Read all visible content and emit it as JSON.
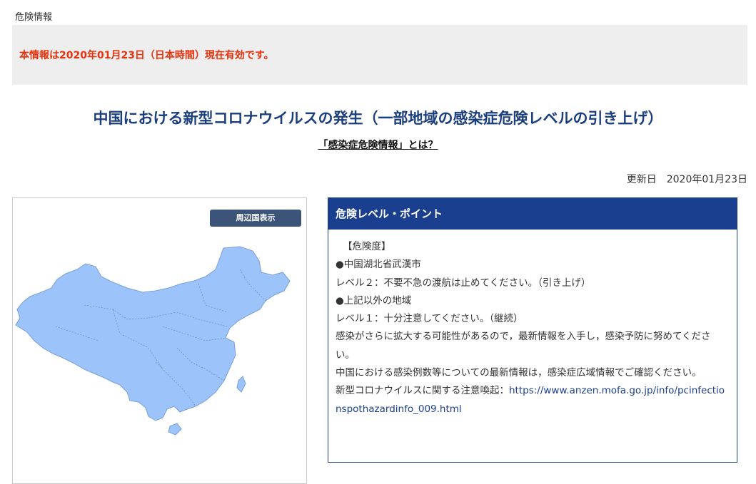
{
  "breadcrumb": "危険情報",
  "notice": "本情報は2020年01月23日（日本時間）現在有効です。",
  "title": "中国における新型コロナウイルスの発生（一部地域の感染症危険レベルの引き上げ）",
  "what_link": "「感染症危険情報」とは？",
  "updated": {
    "label": "更新日",
    "date": "2020年01月23日"
  },
  "map": {
    "button_label": "周辺国表示",
    "region_color": "#9dc3fb"
  },
  "risk_panel": {
    "header": "危険レベル・ポイント",
    "lines": [
      "【危険度】",
      "●中国湖北省武漢市",
      "レベル２：不要不急の渡航は止めてください。（引き上げ）",
      "●上記以外の地域",
      "レベル１：十分注意してください。（継続）",
      "感染がさらに拡大する可能性があるので，最新情報を入手し，感染予防に努めてください。",
      "中国における感染例数等についての最新情報は，感染症広域情報でご確認ください。"
    ],
    "link_prefix": "新型コロナウイルスに関する注意喚起：",
    "link_url": "https://www.anzen.mofa.go.jp/info/pcinfectionspothazardinfo_009.html"
  },
  "colors": {
    "brand_blue": "#1b3f8f",
    "alert_red": "#e8320d",
    "notice_bg": "#eeeeee"
  }
}
